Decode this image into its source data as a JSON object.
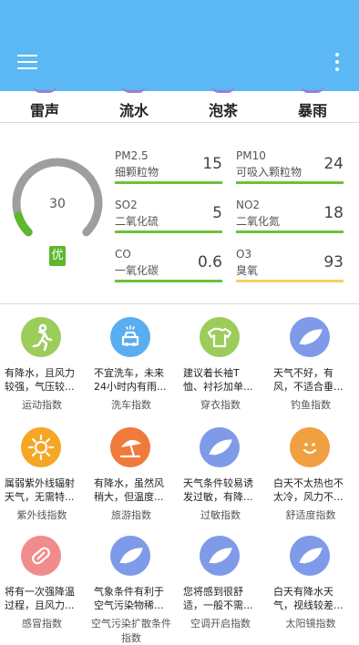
{
  "toolbar": {
    "menu_icon": "menu-icon",
    "more_icon": "more-vert-icon"
  },
  "sounds": [
    {
      "label": "雷声"
    },
    {
      "label": "流水"
    },
    {
      "label": "泡茶"
    },
    {
      "label": "暴雨"
    }
  ],
  "aqi": {
    "value": "30",
    "level": "优",
    "progress": 0.1
  },
  "pollutants": [
    {
      "code": "PM2.5",
      "name": "细颗粒物",
      "value": "15",
      "color": "#6cc13b"
    },
    {
      "code": "PM10",
      "name": "可吸入颗粒物",
      "value": "24",
      "color": "#6cc13b"
    },
    {
      "code": "SO2",
      "name": "二氧化硫",
      "value": "5",
      "color": "#6cc13b"
    },
    {
      "code": "NO2",
      "name": "二氧化氮",
      "value": "18",
      "color": "#6cc13b"
    },
    {
      "code": "CO",
      "name": "一氧化碳",
      "value": "0.6",
      "color": "#6cc13b"
    },
    {
      "code": "O3",
      "name": "臭氧",
      "value": "93",
      "color": "#f2d160"
    }
  ],
  "indices": [
    {
      "desc": "有降水，且风力较强，气压较...",
      "name": "运动指数",
      "icon": "running-icon",
      "color": "#9ccc5a"
    },
    {
      "desc": "不宜洗车，未来24小时内有雨...",
      "name": "洗车指数",
      "icon": "car-wash-icon",
      "color": "#5aaef0"
    },
    {
      "desc": "建议着长袖T恤、衬衫加单...",
      "name": "穿衣指数",
      "icon": "tshirt-icon",
      "color": "#9ccc5a"
    },
    {
      "desc": "天气不好，有风，不适合垂...",
      "name": "钓鱼指数",
      "icon": "leaf-icon",
      "color": "#7f9ae8"
    },
    {
      "desc": "属弱紫外线辐射天气，无需特...",
      "name": "紫外线指数",
      "icon": "sun-icon",
      "color": "#f5a623"
    },
    {
      "desc": "有降水，虽然风稍大，但温度...",
      "name": "旅游指数",
      "icon": "beach-umbrella-icon",
      "color": "#f07a3c"
    },
    {
      "desc": "天气条件较易诱发过敏，有降...",
      "name": "过敏指数",
      "icon": "leaf-icon",
      "color": "#7f9ae8"
    },
    {
      "desc": "白天不太热也不太冷，风力不...",
      "name": "舒适度指数",
      "icon": "smile-icon",
      "color": "#f0a040"
    },
    {
      "desc": "将有一次强降温过程，且风力...",
      "name": "感冒指数",
      "icon": "pill-icon",
      "color": "#f08c8c"
    },
    {
      "desc": "气象条件有利于空气污染物稀...",
      "name": "空气污染扩散条件指数",
      "icon": "leaf-icon",
      "color": "#7f9ae8"
    },
    {
      "desc": "您将感到很舒适，一般不需...",
      "name": "空调开启指数",
      "icon": "leaf-icon",
      "color": "#7f9ae8"
    },
    {
      "desc": "白天有降水天气，视线较差...",
      "name": "太阳镜指数",
      "icon": "leaf-icon",
      "color": "#7f9ae8"
    }
  ]
}
